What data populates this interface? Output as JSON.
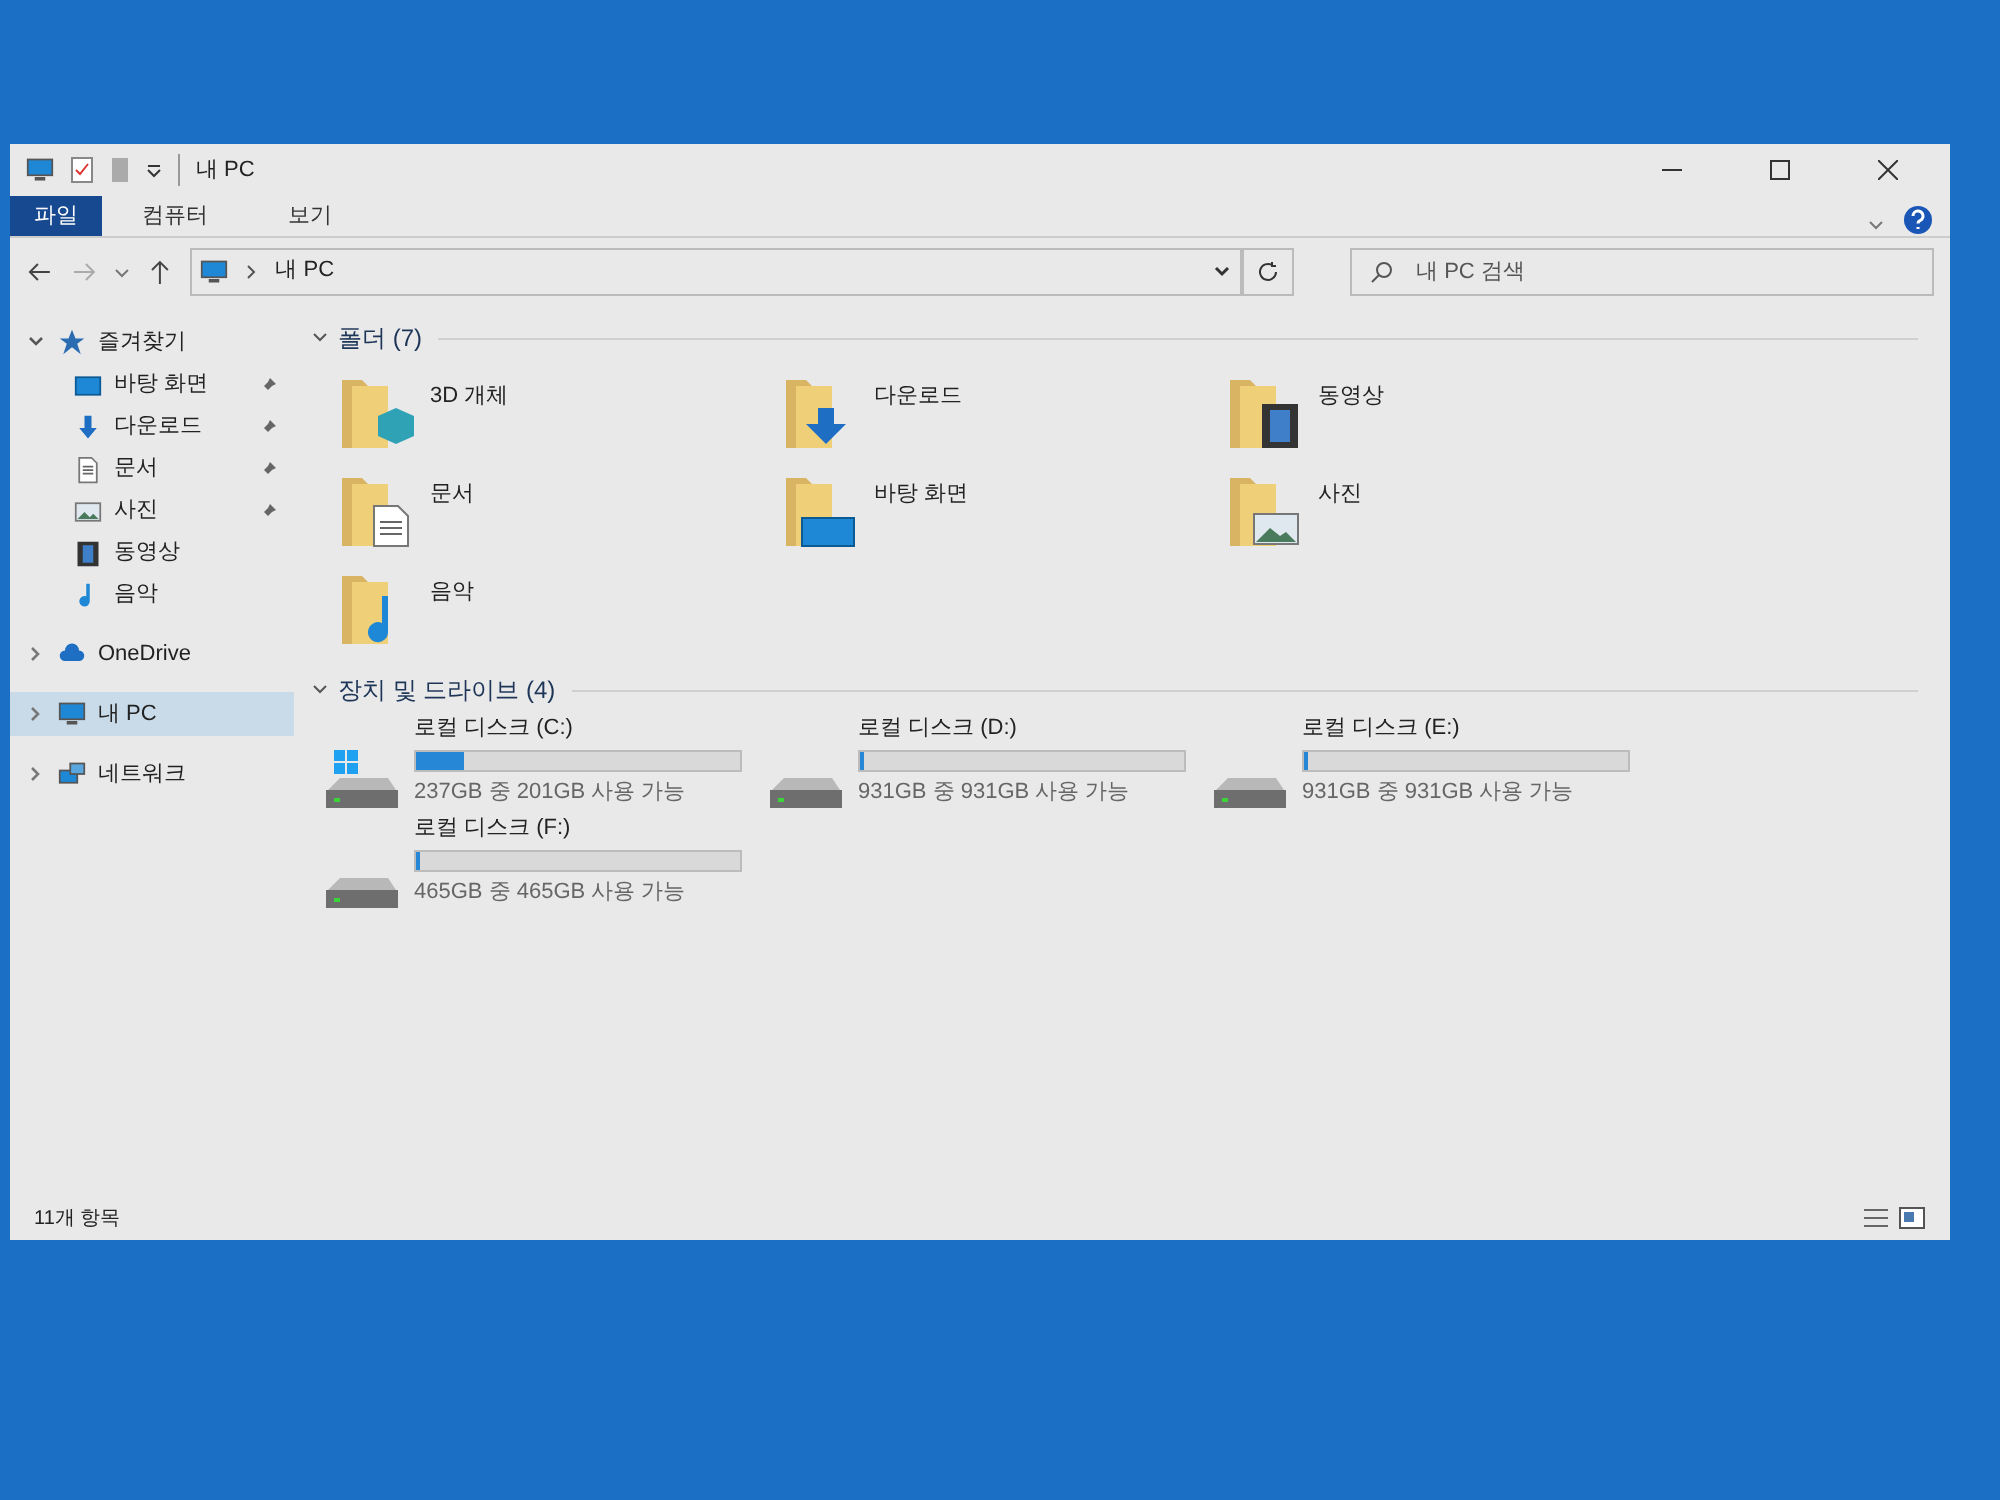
{
  "window": {
    "title": "내 PC"
  },
  "ribbon_tabs": [
    {
      "label": "파일",
      "selected": true
    },
    {
      "label": "컴퓨터",
      "selected": false
    },
    {
      "label": "보기",
      "selected": false
    }
  ],
  "address": {
    "path": "내 PC"
  },
  "search": {
    "placeholder": "내 PC 검색"
  },
  "sidebar": {
    "items": [
      {
        "label": "즐겨찾기",
        "kind": "star",
        "expanded": true,
        "selected": false,
        "children": [
          {
            "label": "바탕 화면",
            "kind": "desktop",
            "pinned": true
          },
          {
            "label": "다운로드",
            "kind": "download",
            "pinned": true
          },
          {
            "label": "문서",
            "kind": "document",
            "pinned": true
          },
          {
            "label": "사진",
            "kind": "picture",
            "pinned": true
          },
          {
            "label": "동영상",
            "kind": "video",
            "pinned": false
          },
          {
            "label": "음악",
            "kind": "music",
            "pinned": false
          }
        ]
      },
      {
        "label": "OneDrive",
        "kind": "cloud",
        "expanded": false,
        "selected": false
      },
      {
        "label": "내 PC",
        "kind": "pc",
        "expanded": false,
        "selected": true
      },
      {
        "label": "네트워크",
        "kind": "network",
        "expanded": false,
        "selected": false
      }
    ]
  },
  "folders": {
    "title": "폴더 (7)",
    "items": [
      {
        "label": "3D 개체",
        "kind": "cube"
      },
      {
        "label": "다운로드",
        "kind": "download"
      },
      {
        "label": "동영상",
        "kind": "video"
      },
      {
        "label": "문서",
        "kind": "document"
      },
      {
        "label": "바탕 화면",
        "kind": "desktop"
      },
      {
        "label": "사진",
        "kind": "picture"
      },
      {
        "label": "음악",
        "kind": "music"
      }
    ]
  },
  "drives": {
    "title": "장치 및 드라이브 (4)",
    "items": [
      {
        "label": "로컬 디스크 (C:)",
        "system": true,
        "level": 0.15,
        "space": "237GB 중 201GB 사용 가능"
      },
      {
        "label": "로컬 디스크 (D:)",
        "system": false,
        "level": 0.01,
        "space": "931GB 중 931GB 사용 가능"
      },
      {
        "label": "로컬 디스크 (E:)",
        "system": false,
        "level": 0.01,
        "space": "931GB 중 931GB 사용 가능"
      },
      {
        "label": "로컬 디스크 (F:)",
        "system": false,
        "level": 0.01,
        "space": "465GB 중 465GB 사용 가능"
      }
    ]
  },
  "status_bar": {
    "count": "11개 항목"
  }
}
